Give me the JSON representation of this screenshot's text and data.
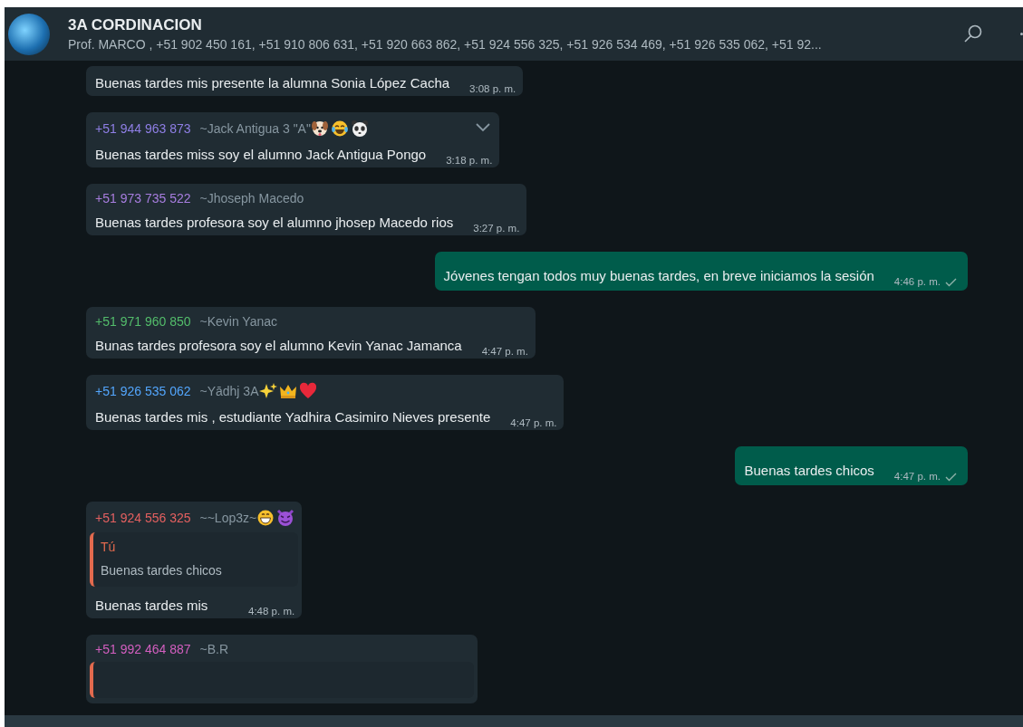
{
  "chat": {
    "title": "3A CORDINACION",
    "participants": "Prof. MARCO , +51 902 450 161, +51 910 806 631, +51 920 663 862, +51 924 556 325, +51 926 534 469, +51 926 535 062, +51 92..."
  },
  "messages": [
    {
      "kind": "incoming",
      "text": "Buenas tardes mis presente la alumna Sonia López Cacha",
      "time": "3:08 p. m."
    },
    {
      "kind": "incoming",
      "sender_phone": "+51 944 963 873",
      "color": "#8f7fe6",
      "sender_name": "~Jack Antigua 3 \"A\"",
      "badges": [
        {
          "kind": "dog"
        },
        {
          "kind": "laugh"
        },
        {
          "kind": "panda"
        }
      ],
      "menu": true,
      "text": "Buenas tardes miss soy el alumno Jack Antigua Pongo",
      "time": "3:18 p. m."
    },
    {
      "kind": "incoming",
      "sender_phone": "+51 973 735 522",
      "color": "#a87ee0",
      "sender_name": "~Jhoseph Macedo",
      "text": "Buenas tardes profesora soy el alumno jhosep Macedo rios",
      "time": "3:27 p. m."
    },
    {
      "kind": "outgoing",
      "text": "Jóvenes tengan todos muy buenas tardes, en breve iniciamos la sesión",
      "time": "4:46 p. m.",
      "sent": true
    },
    {
      "kind": "incoming",
      "sender_phone": "+51 971 960 850",
      "color": "#53bd6b",
      "sender_name": "~Kevin Yanac",
      "text": "Bunas tardes profesora soy el alumno Kevin Yanac Jamanca",
      "time": "4:47 p. m."
    },
    {
      "kind": "incoming",
      "sender_phone": "+51 926 535 062",
      "color": "#53a6fd",
      "sender_name": "~Yādhj 3A",
      "badges": [
        {
          "kind": "sparkles"
        },
        {
          "kind": "crown"
        },
        {
          "kind": "heart"
        }
      ],
      "text": "Buenas tardes mis , estudiante Yadhira Casimiro Nieves presente",
      "time": "4:47 p. m."
    },
    {
      "kind": "outgoing",
      "text": "Buenas tardes chicos",
      "time": "4:47 p. m.",
      "sent": true
    },
    {
      "kind": "incoming",
      "sender_phone": "+51 924 556 325",
      "color": "#e46060",
      "sender_name": "~~Lop3z~",
      "badges": [
        {
          "kind": "grin"
        },
        {
          "kind": "devil"
        }
      ],
      "quote": {
        "author": "Tú",
        "text": "Buenas tardes chicos"
      },
      "text": "Buenas tardes mis",
      "time": "4:48 p. m."
    },
    {
      "kind": "incoming",
      "sender_phone": "+51 992 464 887",
      "color": "#d35fc0",
      "sender_name": "~B.R",
      "quote_cut": true
    }
  ]
}
